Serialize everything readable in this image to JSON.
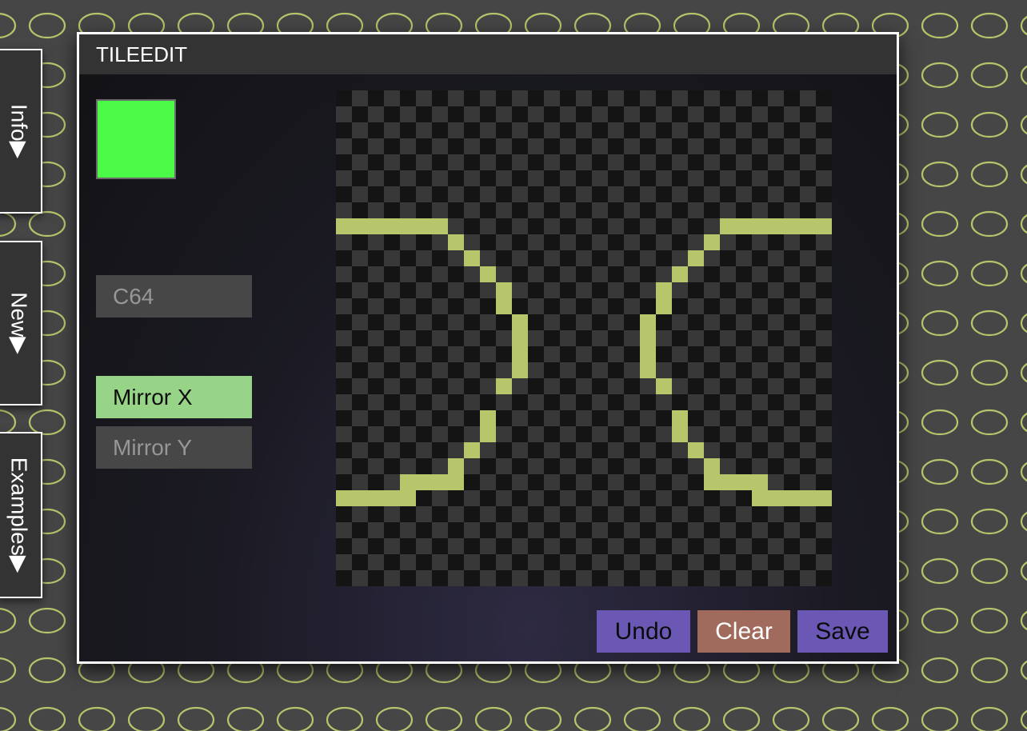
{
  "app": {
    "title": "TILEEDIT"
  },
  "side_tabs": [
    {
      "label": "Info▶"
    },
    {
      "label": "New▶"
    },
    {
      "label": "Examples▶"
    }
  ],
  "editor": {
    "current_color": "#4bfb48",
    "palette_label": "C64",
    "mirror_x_label": "Mirror X",
    "mirror_y_label": "Mirror Y",
    "mirror_x_active": true,
    "mirror_y_active": false,
    "undo_label": "Undo",
    "clear_label": "Clear",
    "save_label": "Save"
  },
  "tile": {
    "grid_cols": 31,
    "grid_rows": 31,
    "checker_colors": [
      "#141414",
      "#383838"
    ],
    "pixel_color": "#b8c66b",
    "filled_cells": [
      [
        0,
        8
      ],
      [
        1,
        8
      ],
      [
        2,
        8
      ],
      [
        3,
        8
      ],
      [
        4,
        8
      ],
      [
        5,
        8
      ],
      [
        6,
        8
      ],
      [
        7,
        9
      ],
      [
        8,
        10
      ],
      [
        9,
        11
      ],
      [
        10,
        12
      ],
      [
        10,
        13
      ],
      [
        11,
        14
      ],
      [
        11,
        15
      ],
      [
        11,
        16
      ],
      [
        11,
        17
      ],
      [
        10,
        18
      ],
      [
        9,
        20
      ],
      [
        9,
        21
      ],
      [
        8,
        22
      ],
      [
        7,
        23
      ],
      [
        4,
        24
      ],
      [
        5,
        24
      ],
      [
        6,
        24
      ],
      [
        7,
        24
      ],
      [
        0,
        25
      ],
      [
        1,
        25
      ],
      [
        2,
        25
      ],
      [
        3,
        25
      ],
      [
        4,
        25
      ]
    ],
    "mirror_x": true
  },
  "colors": {
    "background": "#464646",
    "pattern": "#b5c56c",
    "window_border": "#ffffff",
    "titlebar": "#333333"
  }
}
